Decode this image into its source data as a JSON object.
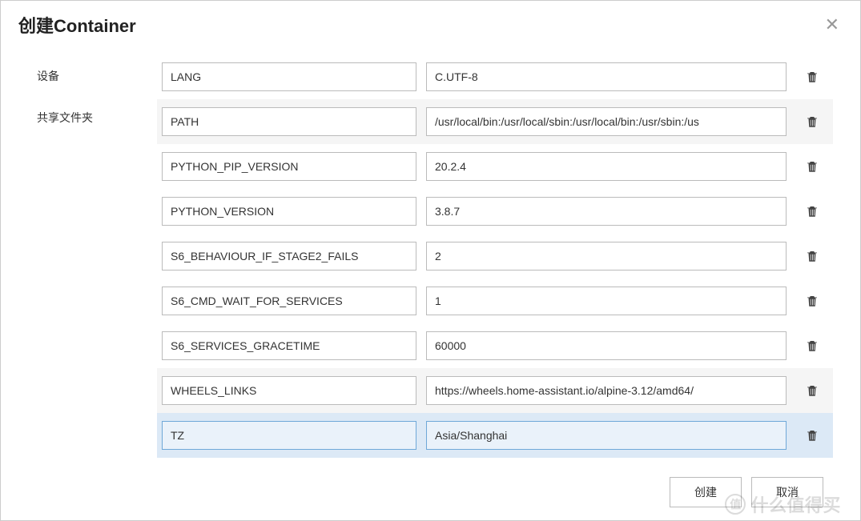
{
  "modal": {
    "title": "创建Container"
  },
  "sidebar": {
    "items": [
      {
        "label": "设备"
      },
      {
        "label": "共享文件夹"
      }
    ]
  },
  "envVars": [
    {
      "key": "LANG",
      "value": "C.UTF-8",
      "alt": false,
      "selected": false
    },
    {
      "key": "PATH",
      "value": "/usr/local/bin:/usr/local/sbin:/usr/local/bin:/usr/sbin:/us",
      "alt": true,
      "selected": false
    },
    {
      "key": "PYTHON_PIP_VERSION",
      "value": "20.2.4",
      "alt": false,
      "selected": false
    },
    {
      "key": "PYTHON_VERSION",
      "value": "3.8.7",
      "alt": false,
      "selected": false
    },
    {
      "key": "S6_BEHAVIOUR_IF_STAGE2_FAILS",
      "value": "2",
      "alt": false,
      "selected": false
    },
    {
      "key": "S6_CMD_WAIT_FOR_SERVICES",
      "value": "1",
      "alt": false,
      "selected": false
    },
    {
      "key": "S6_SERVICES_GRACETIME",
      "value": "60000",
      "alt": false,
      "selected": false
    },
    {
      "key": "WHEELS_LINKS",
      "value": "https://wheels.home-assistant.io/alpine-3.12/amd64/",
      "alt": true,
      "selected": false
    },
    {
      "key": "TZ",
      "value": "Asia/Shanghai",
      "alt": false,
      "selected": true
    }
  ],
  "footer": {
    "create": "创建",
    "cancel": "取消"
  },
  "watermark": "什么值得买"
}
